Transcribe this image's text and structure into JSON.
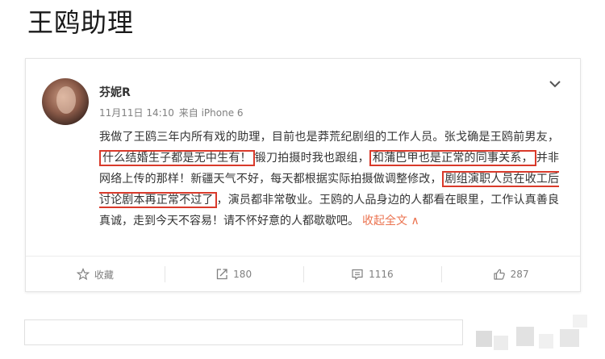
{
  "page": {
    "title": "王鸥助理"
  },
  "post": {
    "author": "芬妮R",
    "timestamp": "11月11日 14:10",
    "source": "来自 iPhone 6",
    "segments": [
      {
        "text": "我做了王鸥三年内所有戏的助理，目前也是莽荒纪剧组的工作人员。张戈确是王鸥前男友，",
        "highlight": false
      },
      {
        "text": "什么结婚生子都是无中生有！",
        "highlight": true
      },
      {
        "text": "锻刀拍摄时我也跟组，",
        "highlight": false
      },
      {
        "text": "和蒲巴甲也是正常的同事关系，",
        "highlight": true
      },
      {
        "text": "并非网络上传的那样！新疆天气不好，每天都根据实际拍摄做调整修改，",
        "highlight": false
      },
      {
        "text": "剧组演职人员在收工后讨论剧本再正常不过了",
        "highlight": true
      },
      {
        "text": "，演员都非常敬业。王鸥的人品身边的人都看在眼里，工作认真善良真诚，走到今天不容易！请不怀好意的人都歇歇吧。",
        "highlight": false
      }
    ],
    "collapse_label": "收起全文 ∧"
  },
  "actions": {
    "favorite": "收藏",
    "repost": "180",
    "comments": "1116",
    "likes": "287"
  },
  "colors": {
    "highlight": "#d93a2b",
    "link": "#eb7350",
    "muted": "#808080"
  },
  "icons": [
    "chevron-down-icon",
    "star-icon",
    "repost-icon",
    "comment-icon",
    "thumbs-up-icon"
  ]
}
